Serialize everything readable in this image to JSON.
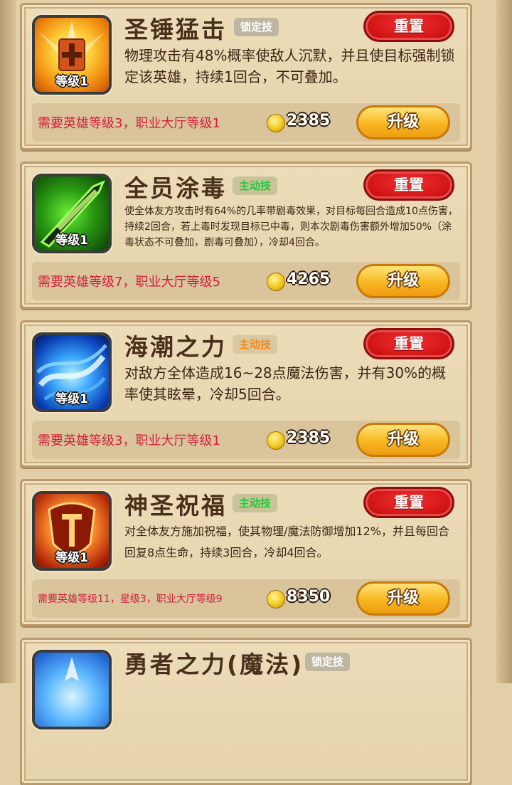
{
  "labels": {
    "reset": "重置",
    "upgrade": "升级"
  },
  "skills": [
    {
      "name": "圣锤猛击",
      "badge": "锁定技",
      "level": "等级1",
      "description": "物理攻击有48%概率使敌人沉默，并且使目标强制锁定该英雄，持续1回合，不可叠加。",
      "requirement": "需要英雄等级3，职业大厅等级1",
      "cost": "2385",
      "icon": "hammer-strike-icon"
    },
    {
      "name": "全员涂毒",
      "badge": "主动技",
      "level": "等级1",
      "description": "使全体友方攻击时有64%的几率带剧毒效果，对目标每回合造成10点伤害，持续2回合，若上毒时发现目标已中毒，则本次剧毒伤害额外增加50%（涂毒状态不可叠加，剧毒可叠加），冷却4回合。",
      "requirement": "需要英雄等级7，职业大厅等级5",
      "cost": "4265",
      "icon": "poison-blade-icon"
    },
    {
      "name": "海潮之力",
      "badge": "主动技",
      "level": "等级1",
      "description": "对敌方全体造成16~28点魔法伤害，并有30%的概率使其眩晕，冷却5回合。",
      "requirement": "需要英雄等级3，职业大厅等级1",
      "cost": "2385",
      "icon": "tide-wave-icon"
    },
    {
      "name": "神圣祝福",
      "badge": "主动技",
      "level": "等级1",
      "description": "对全体友方施加祝福，使其物理/魔法防御增加12%，并且每回合回复8点生命，持续3回合，冷却4回合。",
      "requirement": "需要英雄等级11，星级3，职业大厅等级9",
      "cost": "8350",
      "icon": "holy-armor-icon"
    },
    {
      "name": "勇者之力(魔法)",
      "badge": "锁定技",
      "icon": "brave-power-icon"
    }
  ]
}
